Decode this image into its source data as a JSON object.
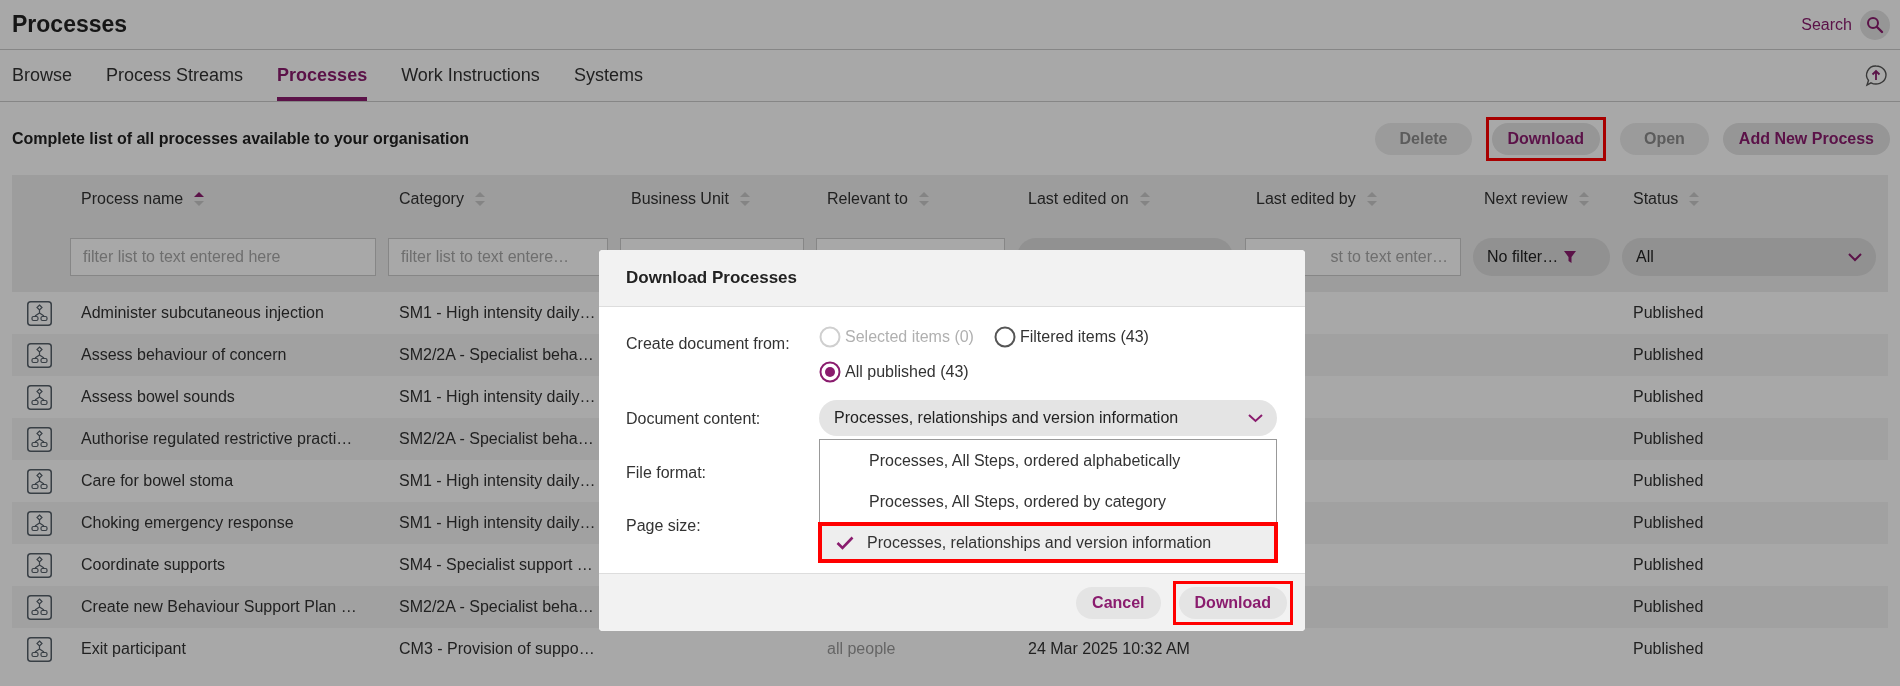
{
  "page": {
    "title": "Processes",
    "search_label": "Search"
  },
  "tabs": [
    {
      "label": "Browse",
      "selected": false
    },
    {
      "label": "Process Streams",
      "selected": false
    },
    {
      "label": "Processes",
      "selected": true
    },
    {
      "label": "Work Instructions",
      "selected": false
    },
    {
      "label": "Systems",
      "selected": false
    }
  ],
  "toolbar": {
    "description": "Complete list of all processes available to your organisation",
    "buttons": [
      {
        "label": "Delete",
        "disabled": true,
        "highlighted": false
      },
      {
        "label": "Download",
        "disabled": false,
        "highlighted": true
      },
      {
        "label": "Open",
        "disabled": true,
        "highlighted": false
      },
      {
        "label": "Add New Process",
        "disabled": false,
        "highlighted": false
      }
    ]
  },
  "table": {
    "columns": [
      {
        "label": "Process name",
        "sorted": true
      },
      {
        "label": "Category",
        "sorted": false
      },
      {
        "label": "Business Unit",
        "sorted": false
      },
      {
        "label": "Relevant to",
        "sorted": false
      },
      {
        "label": "Last edited on",
        "sorted": false
      },
      {
        "label": "Last edited by",
        "sorted": false
      },
      {
        "label": "Next review",
        "sorted": false
      },
      {
        "label": "Status",
        "sorted": false
      }
    ],
    "filters": [
      {
        "kind": "text",
        "placeholder": "filter list to text entered here"
      },
      {
        "kind": "text",
        "placeholder": "filter list to text entere…"
      },
      {
        "kind": "text"
      },
      {
        "kind": "text"
      },
      {
        "kind": "pill"
      },
      {
        "kind": "text",
        "placeholder": "st to text enter…"
      },
      {
        "kind": "menu",
        "value": "No filter…"
      },
      {
        "kind": "select",
        "value": "All"
      }
    ],
    "rows": [
      {
        "name": "Administer subcutaneous injection",
        "category": "SM1 - High intensity daily…",
        "status": "Published"
      },
      {
        "name": "Assess behaviour of concern",
        "category": "SM2/2A - Specialist beha…",
        "status": "Published"
      },
      {
        "name": "Assess bowel sounds",
        "category": "SM1 - High intensity daily…",
        "status": "Published"
      },
      {
        "name": "Authorise regulated restrictive practi…",
        "category": "SM2/2A - Specialist beha…",
        "status": "Published"
      },
      {
        "name": "Care for bowel stoma",
        "category": "SM1 - High intensity daily…",
        "status": "Published"
      },
      {
        "name": "Choking emergency response",
        "category": "SM1 - High intensity daily…",
        "status": "Published"
      },
      {
        "name": "Coordinate supports",
        "category": "SM4 - Specialist support …",
        "status": "Published"
      },
      {
        "name": "Create new Behaviour Support Plan …",
        "category": "SM2/2A - Specialist beha…",
        "status": "Published"
      },
      {
        "name": "Exit participant",
        "category": "CM3 - Provision of suppo…",
        "relevant_to": "all people",
        "last_edited_on": "24 Mar 2025 10:32 AM",
        "status": "Published"
      }
    ]
  },
  "dialog": {
    "title": "Download Processes",
    "source_label": "Create document from:",
    "source_options": [
      {
        "label": "Selected items (0)",
        "selected": false,
        "disabled": true
      },
      {
        "label": "Filtered items (43)",
        "selected": false,
        "disabled": false
      },
      {
        "label": "All published (43)",
        "selected": true,
        "disabled": false
      }
    ],
    "content_label": "Document content:",
    "content_value": "Processes, relationships and version information",
    "content_options": [
      {
        "label": "Processes, All Steps, ordered alphabetically",
        "selected": false,
        "highlighted": false
      },
      {
        "label": "Processes, All Steps, ordered by category",
        "selected": false,
        "highlighted": false
      },
      {
        "label": "Processes, relationships and version information",
        "selected": true,
        "highlighted": true
      }
    ],
    "format_label": "File format:",
    "size_label": "Page size:",
    "buttons": [
      {
        "label": "Cancel",
        "highlighted": false
      },
      {
        "label": "Download",
        "highlighted": true
      }
    ]
  }
}
